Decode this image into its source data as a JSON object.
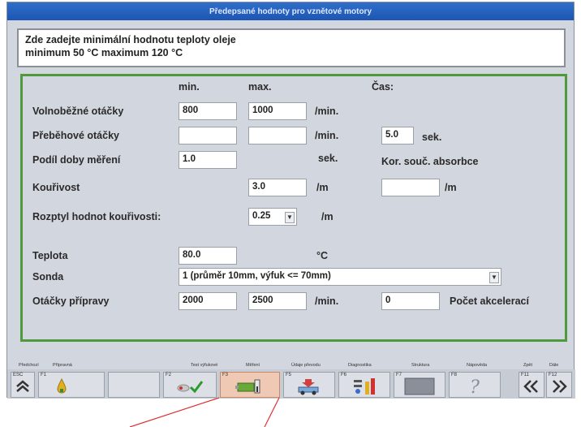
{
  "window": {
    "title": "Předepsané hodnoty pro vznětové motory"
  },
  "info": {
    "line1": "Zde zadejte minimální hodnotu teploty oleje",
    "line2": "minimum 50 °C maximum 120 °C"
  },
  "headers": {
    "min": "min.",
    "max": "max.",
    "time": "Čas:"
  },
  "rows": {
    "idle": {
      "label": "Volnoběžné otáčky",
      "min": "800",
      "max": "1000",
      "unit": "/min."
    },
    "overrun": {
      "label": "Přeběhové otáčky",
      "min": "",
      "max": "",
      "unit": "/min.",
      "time_value": "5.0",
      "time_unit": "sek."
    },
    "share": {
      "label": "Podíl doby měření",
      "value": "1.0",
      "unit": "sek.",
      "absorb_label": "Kor. souč. absorbce"
    },
    "smoke": {
      "label": "Kouřivost",
      "value": "3.0",
      "unit": "/m",
      "absorb_value": "",
      "absorb_unit": "/m"
    },
    "spread": {
      "label": "Rozptyl hodnot kouřivosti:",
      "value": "0.25",
      "unit": "/m"
    },
    "temp": {
      "label": "Teplota",
      "value": "80.0",
      "unit": "°C"
    },
    "probe": {
      "label": "Sonda",
      "value": "1 (průměr 10mm, výfuk <= 70mm)"
    },
    "prep": {
      "label": "Otáčky přípravy",
      "min": "2000",
      "max": "2500",
      "unit": "/min.",
      "accel_value": "0",
      "accel_label": "Počet akcelerací"
    }
  },
  "fkeys": {
    "labels": [
      "Předchozí",
      "Přípravná",
      "Test výfukové",
      "Měření",
      "Údaje převodu",
      "Diagnostika",
      "Struktura",
      "Nápověda",
      "Zpět",
      "Dále"
    ],
    "esc": "ESC",
    "f1": "F1",
    "f2": "F2",
    "f3": "F3",
    "f4": "F4",
    "f5": "F5",
    "f6": "F6",
    "f7": "F7",
    "f8": "F8",
    "f11": "F11",
    "f12": "F12"
  },
  "colors": {
    "title_bar": "#1d55b3",
    "frame_green": "#4f9a3a",
    "panel": "#d2d6de",
    "active_key": "#f0c9b4",
    "callout_line": "#e03030"
  }
}
